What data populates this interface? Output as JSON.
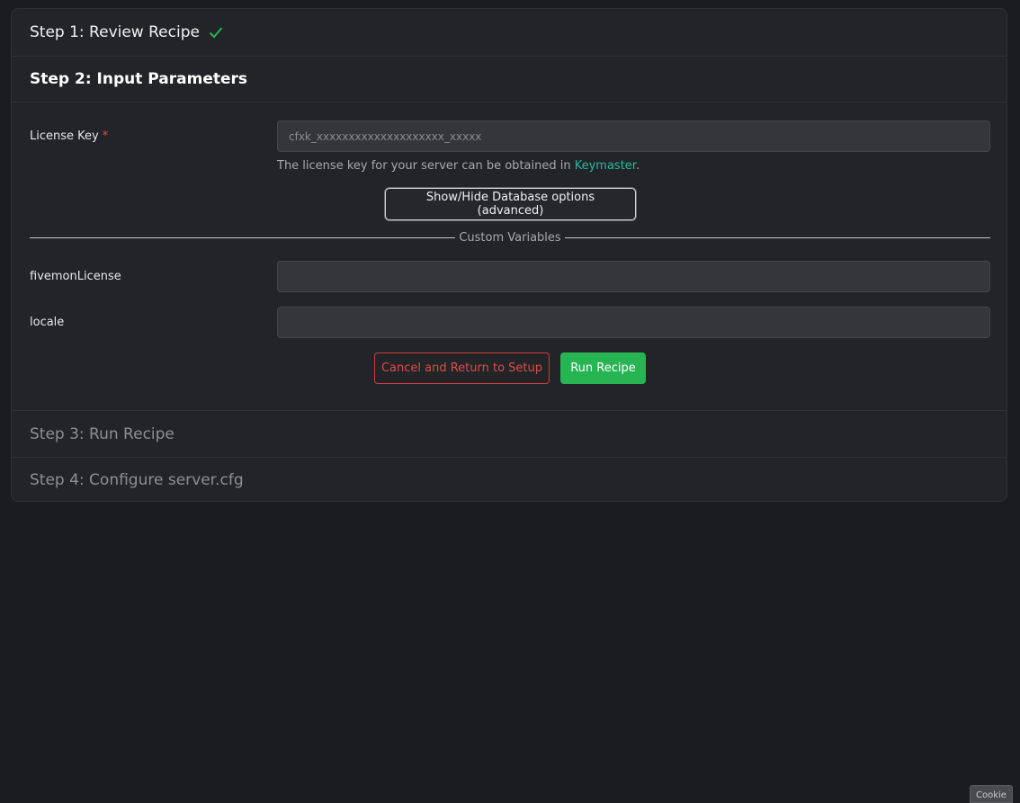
{
  "steps": {
    "step1": {
      "label": "Step 1: Review Recipe",
      "check_icon": "check-icon",
      "check_color": "#27b554"
    },
    "step2": {
      "label": "Step 2: Input Parameters"
    },
    "step3": {
      "label": "Step 3: Run Recipe"
    },
    "step4": {
      "label": "Step 4: Configure server.cfg"
    }
  },
  "form": {
    "license_key": {
      "label": "License Key",
      "required_mark": "*",
      "placeholder": "cfxk_xxxxxxxxxxxxxxxxxxxx_xxxxx",
      "value": "",
      "help_prefix": "The license key for your server can be obtained in ",
      "help_link": "Keymaster",
      "help_suffix": "."
    },
    "advanced_button_label": "Show/Hide Database options (advanced)",
    "custom_variables_title": "Custom Variables",
    "variables": [
      {
        "label": "fivemonLicense",
        "value": ""
      },
      {
        "label": "locale",
        "value": ""
      }
    ],
    "cancel_label": "Cancel and Return to Setup",
    "run_label": "Run Recipe"
  },
  "corner_tab_label": "Cookie",
  "colors": {
    "accent_green": "#27b554",
    "danger_red": "#e04a4a",
    "link_teal": "#27b99e",
    "background": "#1b1c1f",
    "panel": "#232428"
  }
}
